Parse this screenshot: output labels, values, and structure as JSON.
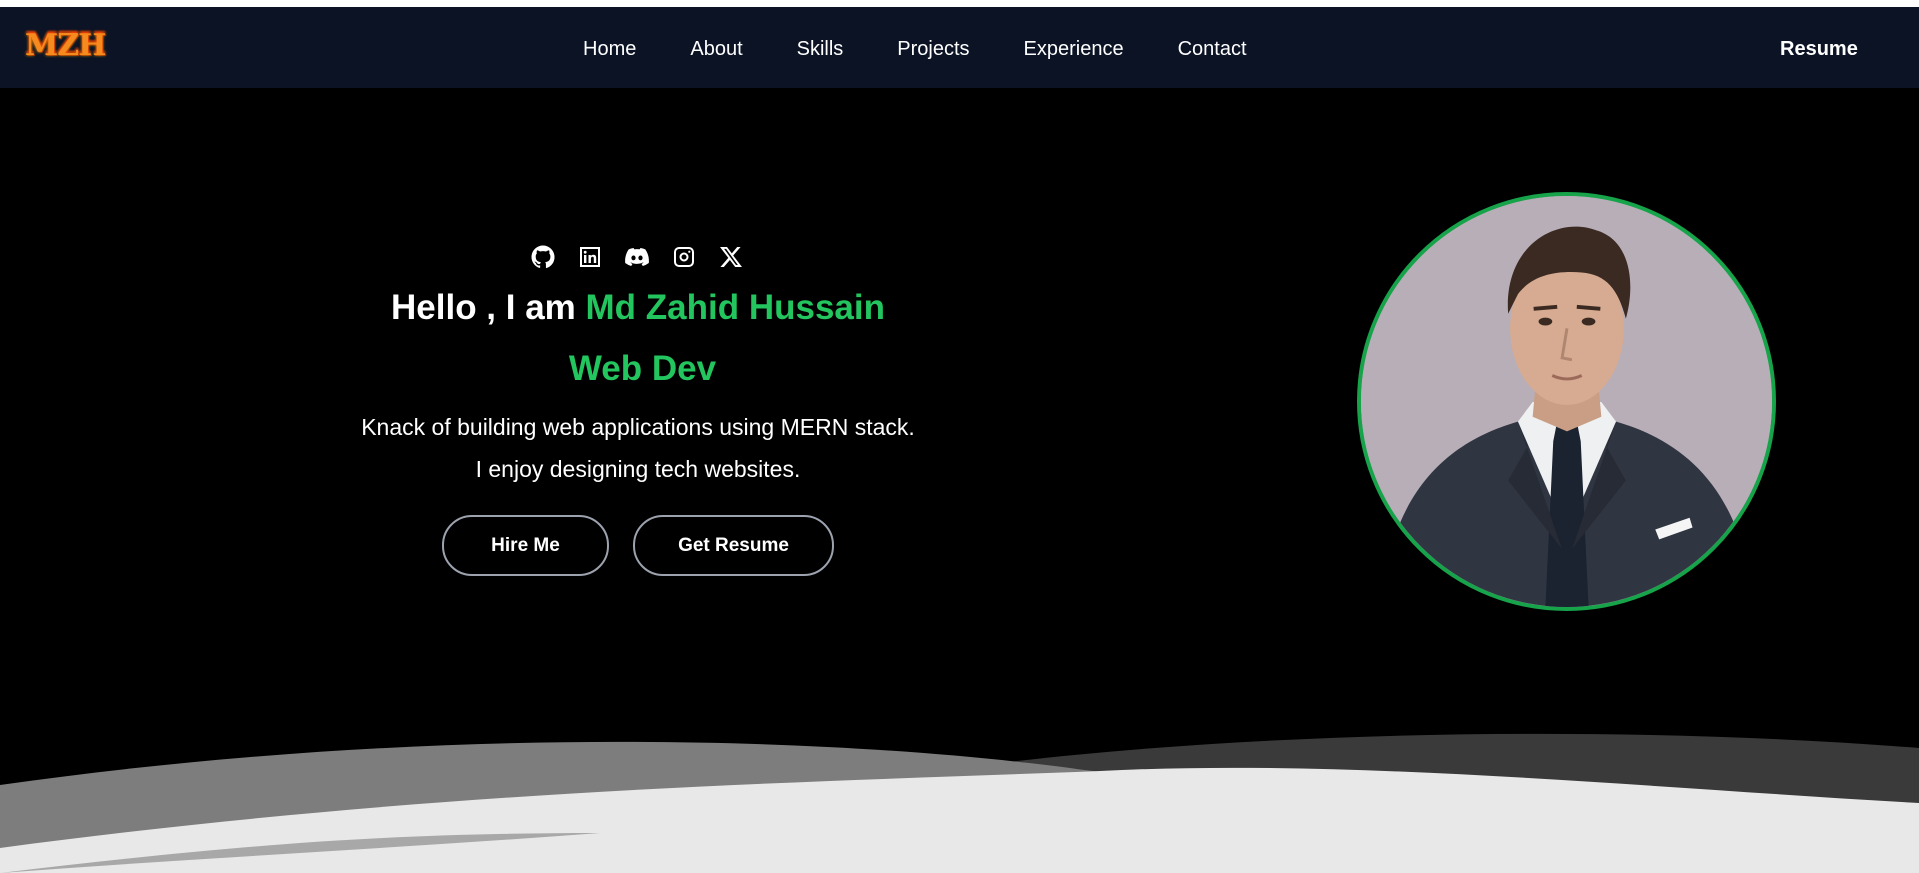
{
  "navbar": {
    "logo": "MZH",
    "links": [
      "Home",
      "About",
      "Skills",
      "Projects",
      "Experience",
      "Contact"
    ],
    "resume_label": "Resume"
  },
  "hero": {
    "socials": [
      "github-icon",
      "linkedin-icon",
      "discord-icon",
      "instagram-icon",
      "x-icon"
    ],
    "greeting_prefix": "Hello , I am ",
    "name": "Md Zahid Hussain",
    "role": "Web Dev",
    "tagline_line1": "Knack of building web applications using MERN stack.",
    "tagline_line2": "I enjoy designing tech websites.",
    "hire_button": "Hire Me",
    "resume_button": "Get Resume"
  },
  "colors": {
    "accent": "#22c55e",
    "navbar_bg": "#0b1325",
    "avatar_ring": "#16a34a"
  }
}
